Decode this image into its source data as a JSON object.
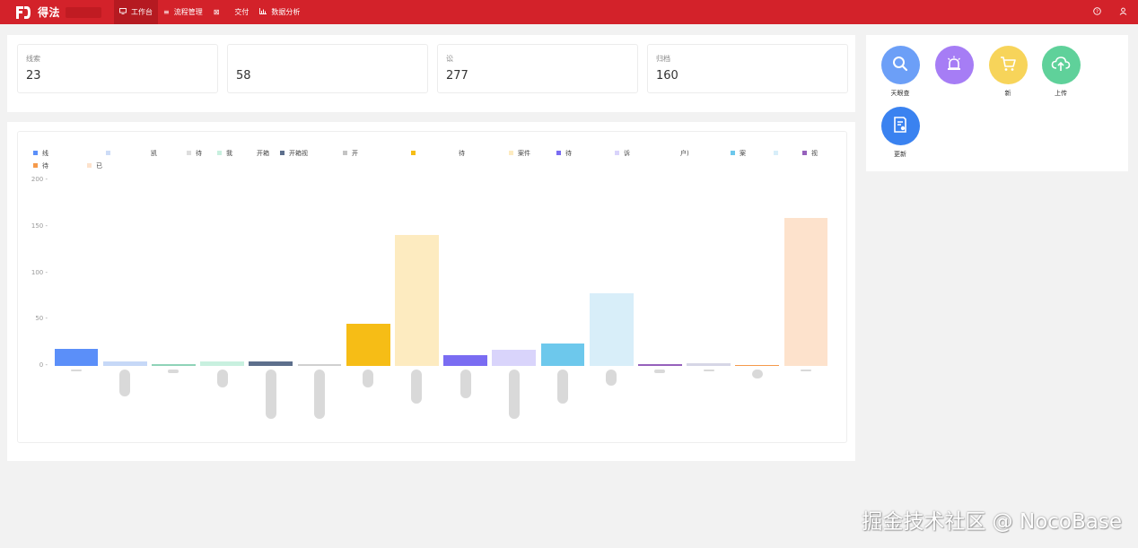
{
  "app": {
    "title": "得法"
  },
  "nav": [
    {
      "label": "工作台",
      "icon": "monitor-icon",
      "active": true
    },
    {
      "label": "流程管理",
      "icon": "list-icon",
      "active": false
    },
    {
      "label": "",
      "icon": "grid-icon",
      "active": false
    },
    {
      "label": "交付",
      "icon": "",
      "active": false
    },
    {
      "label": "数据分析",
      "icon": "bar-chart-icon",
      "active": false
    }
  ],
  "stats": [
    {
      "label": "线索",
      "value": "23"
    },
    {
      "label": "",
      "value": "58"
    },
    {
      "label": "讼",
      "value": "277"
    },
    {
      "label": "归档",
      "value": "160"
    }
  ],
  "chart_data": {
    "type": "bar",
    "ylim": [
      0,
      200
    ],
    "yticks": [
      "200",
      "150",
      "100",
      "50",
      "0"
    ],
    "legend_position": "top",
    "legend": [
      {
        "name": "线",
        "color": "#5b8ff9"
      },
      {
        "name": "",
        "color": "#cddcf7"
      },
      {
        "name": "凯",
        "color": "#ffffff"
      },
      {
        "name": "待"
      },
      {
        "name": "我",
        "color": "#c8f0df"
      },
      {
        "name": "开箱",
        "color": "#ffffff"
      },
      {
        "name": "开箱视",
        "color": "#5d6f8c"
      },
      {
        "name": "开",
        "color": "#c4c4c4"
      },
      {
        "name": "",
        "color": "#f6bd16"
      },
      {
        "name": "待",
        "color": "#ffffff"
      },
      {
        "name": "案件",
        "color": "#fdebc0"
      },
      {
        "name": "待",
        "color": "#7a6cf2"
      },
      {
        "name": "诉",
        "color": "#d9d4fb"
      },
      {
        "name": "户)",
        "color": "#ffffff"
      },
      {
        "name": "案",
        "color": "#6dc8ec"
      },
      {
        "name": "",
        "color": "#d8eef9"
      },
      {
        "name": "视",
        "color": "#9661bc"
      },
      {
        "name": "我",
        "color": "#d6d6d6"
      },
      {
        "name": "待",
        "color": "#f59a4b"
      },
      {
        "name": "已",
        "color": "#fde2cc"
      }
    ],
    "series": [
      {
        "value": 18,
        "color": "#5b8ff9"
      },
      {
        "value": 5,
        "color": "#c6d8f7"
      },
      {
        "value": 2,
        "color": "#8fd3b8"
      },
      {
        "value": 5,
        "color": "#c8f0df"
      },
      {
        "value": 5,
        "color": "#5d6f8c"
      },
      {
        "value": 2,
        "color": "#d0d0d0"
      },
      {
        "value": 45,
        "color": "#f6bd16"
      },
      {
        "value": 141,
        "color": "#fdebc0"
      },
      {
        "value": 12,
        "color": "#7a6cf2"
      },
      {
        "value": 17,
        "color": "#d9d4fb"
      },
      {
        "value": 24,
        "color": "#6dc8ec"
      },
      {
        "value": 78,
        "color": "#d8eef9"
      },
      {
        "value": 2,
        "color": "#9661bc"
      },
      {
        "value": 3,
        "color": "#d6d6e6"
      },
      {
        "value": 1,
        "color": "#f59a4b"
      },
      {
        "value": 159,
        "color": "#fde2cc"
      }
    ]
  },
  "shortcuts": [
    {
      "label": "天眼查",
      "icon": "search-icon",
      "color": "#6c9ff7"
    },
    {
      "label": "",
      "icon": "alarm-icon",
      "color": "#a67df5"
    },
    {
      "label": "新",
      "icon": "cart-icon",
      "color": "#f7d45a"
    },
    {
      "label": "上传",
      "icon": "cloud-upload-icon",
      "color": "#5fd19a"
    },
    {
      "label": "更新",
      "icon": "file-check-icon",
      "color": "#3a82f0"
    }
  ],
  "watermark": "掘金技术社区 @ NocoBase"
}
